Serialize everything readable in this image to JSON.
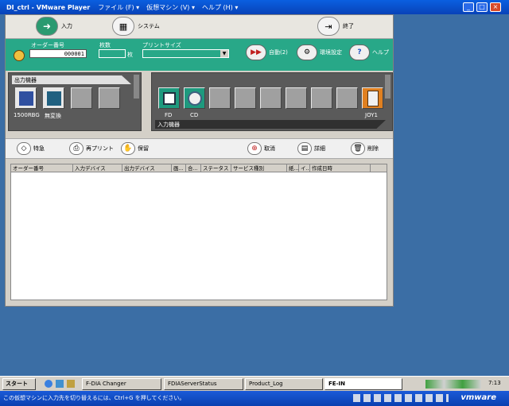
{
  "window": {
    "title": "DI_ctrl - VMware Player",
    "menus": [
      "ファイル (F) ▾",
      "仮想マシン (V) ▾",
      "ヘルプ (H) ▾"
    ]
  },
  "topbar": {
    "input_label": "入力",
    "system_label": "システム",
    "exit_label": "終了"
  },
  "order": {
    "order_no_label": "オーダー番号",
    "order_no_value": "000001",
    "sheets_label": "枚数",
    "sheets_unit": "枚",
    "print_size_label": "プリントサイズ",
    "auto_label": "自動(2)",
    "env_label": "環境設定",
    "help_label": "ヘルプ"
  },
  "output_panel": {
    "title": "出力機器",
    "devices": [
      "1500RBG",
      "無変換"
    ]
  },
  "input_panel": {
    "title": "入力機器",
    "devices": [
      "FD",
      "CD",
      "JOY1"
    ]
  },
  "actions": {
    "special": "特急",
    "reprint": "再プリント",
    "hold": "保留",
    "delete_pending": "取消",
    "detail": "詳細",
    "delete": "削除"
  },
  "table": {
    "columns": [
      "オーダー番号",
      "入力デバイス",
      "出力デバイス",
      "画...",
      "合...",
      "ステータス",
      "サービス種別",
      "紙...",
      "イ...",
      "作成日時"
    ]
  },
  "taskbar": {
    "start": "スタート",
    "items": [
      "F-DIA Changer",
      "FDIAServerStatus",
      "Product_Log",
      "FE-IN"
    ],
    "time": "7:13"
  },
  "statusbar": {
    "message": "この仮想マシンに入力先を切り替えるには、Ctrl+G を押してください。",
    "brand": "vmware"
  }
}
